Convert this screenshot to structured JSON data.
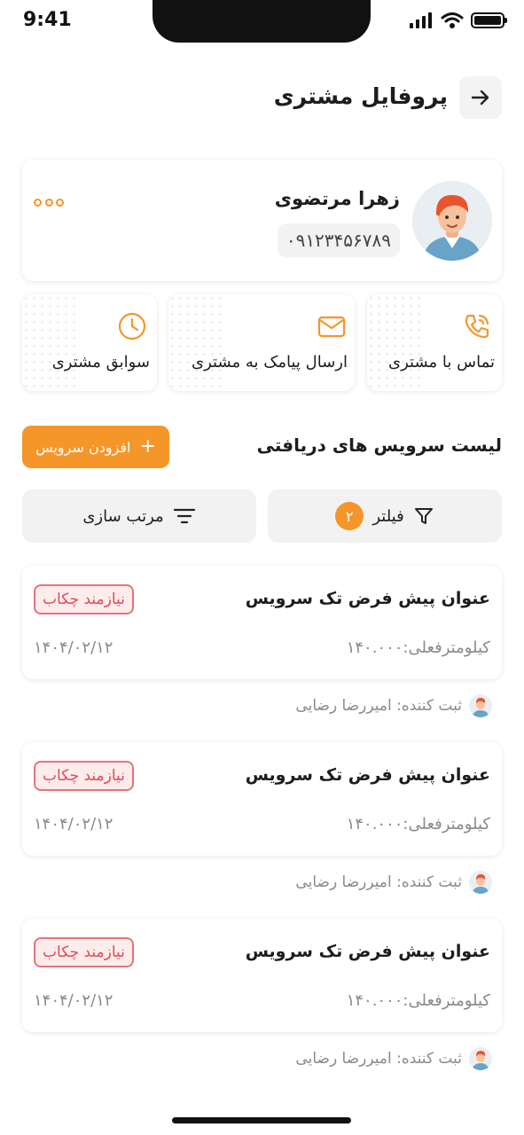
{
  "status_bar": {
    "time": "9:41"
  },
  "header": {
    "title": "پروفایل مشتری",
    "back_icon": "arrow-right-icon"
  },
  "profile": {
    "name": "زهرا مرتضوی",
    "phone": "۰۹۱۲۳۴۵۶۷۸۹"
  },
  "actions": [
    {
      "label": "تماس با مشتری",
      "icon": "phone-icon"
    },
    {
      "label": "ارسال پیامک به مشتری",
      "icon": "mail-icon"
    },
    {
      "label": "سوابق مشتری",
      "icon": "clock-icon"
    }
  ],
  "services_section": {
    "title": "لیست سرویس های دریافتی",
    "add_label": "افزودن سرویس",
    "filter_label": "فیلتر",
    "filter_count": "۲",
    "sort_label": "مرتب سازی"
  },
  "services": [
    {
      "title": "عنوان پیش فرض تک سرویس",
      "status": "نیازمند چکاب",
      "km": "کیلومترفعلی:۱۴۰.۰۰۰",
      "date": "۱۴۰۴/۰۲/۱۲",
      "registrar": "ثبت کننده: امیررضا رضایی"
    },
    {
      "title": "عنوان پیش فرض تک سرویس",
      "status": "نیازمند چکاب",
      "km": "کیلومترفعلی:۱۴۰.۰۰۰",
      "date": "۱۴۰۴/۰۲/۱۲",
      "registrar": "ثبت کننده: امیررضا رضایی"
    },
    {
      "title": "عنوان پیش فرض تک سرویس",
      "status": "نیازمند چکاب",
      "km": "کیلومترفعلی:۱۴۰.۰۰۰",
      "date": "۱۴۰۴/۰۲/۱۲",
      "registrar": "ثبت کننده: امیررضا رضایی"
    }
  ],
  "colors": {
    "accent": "#f5962a",
    "status_red": "#e04a55"
  }
}
